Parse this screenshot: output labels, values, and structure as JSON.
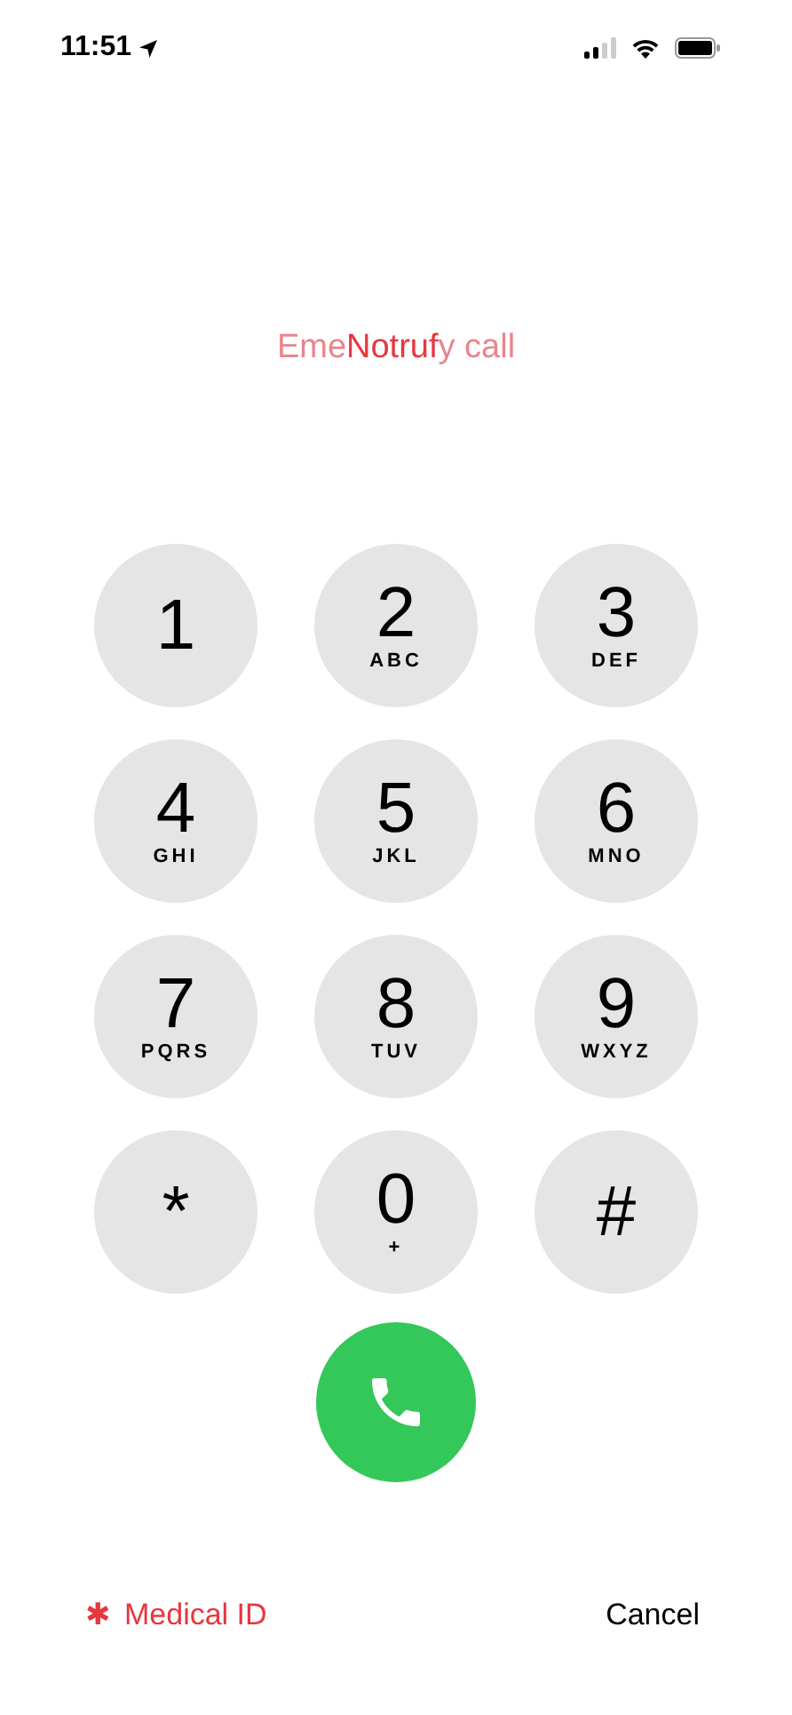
{
  "status_bar": {
    "time": "11:51"
  },
  "header": {
    "behind_left": "Eme",
    "label": "Notruf",
    "behind_right": "y call"
  },
  "keys": [
    {
      "digit": "1"
    },
    {
      "digit": "2",
      "letters": "ABC"
    },
    {
      "digit": "3",
      "letters": "DEF"
    },
    {
      "digit": "4",
      "letters": "GHI"
    },
    {
      "digit": "5",
      "letters": "JKL"
    },
    {
      "digit": "6",
      "letters": "MNO"
    },
    {
      "digit": "7",
      "letters": "PQRS"
    },
    {
      "digit": "8",
      "letters": "TUV"
    },
    {
      "digit": "9",
      "letters": "WXYZ"
    },
    {
      "digit": "*"
    },
    {
      "digit": "0",
      "letters": "+"
    },
    {
      "digit": "#"
    }
  ],
  "footer": {
    "medical_mark": "✱",
    "medical_id": "Medical ID",
    "cancel": "Cancel"
  }
}
